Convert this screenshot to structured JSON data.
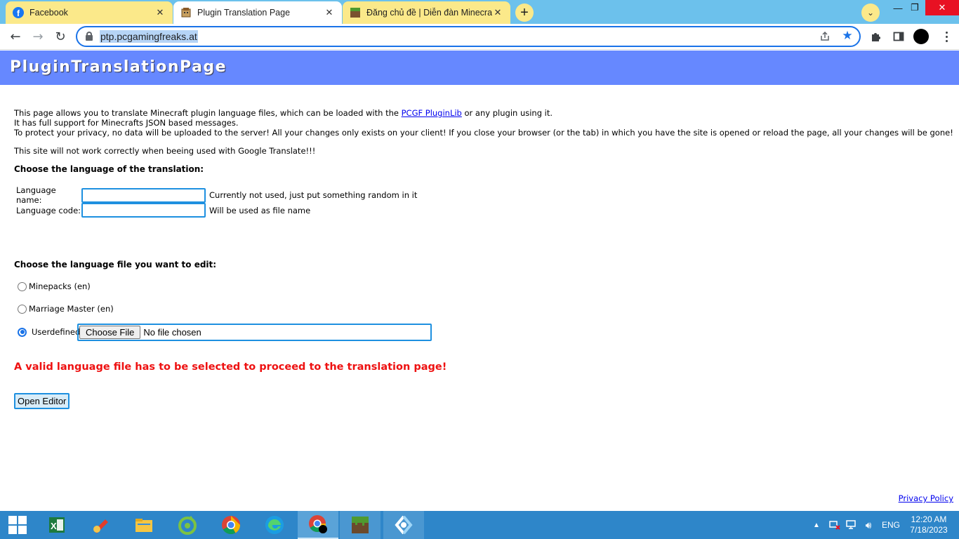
{
  "browser": {
    "tabs": [
      {
        "label": "Facebook",
        "icon": "facebook-icon",
        "active": false
      },
      {
        "label": "Plugin Translation Page",
        "icon": "ptp-favicon-icon",
        "active": true
      },
      {
        "label": "Đăng chủ đề | Diễn đàn Minecraft",
        "icon": "minecraft-grass-icon",
        "active": false
      }
    ],
    "new_tab_symbol": "+",
    "url": "ptp.pcgamingfreaks.at",
    "accent_color": "#1a73e8"
  },
  "page": {
    "banner_title": "PluginTranslationPage",
    "banner_color": "#6688ff",
    "intro_part1": "This page allows you to translate Minecraft plugin language files, which can be loaded with the ",
    "intro_link": "PCGF PluginLib",
    "intro_part2": " or any plugin using it.",
    "intro_line2": "It has full support for Minecrafts JSON based messages.",
    "intro_line3": "To protect your privacy, no data will be uploaded to the server! All your changes only exists on your client! If you close your browser (or the tab) in which you have the site is opened or reload the page, all your changes will be gone!",
    "gt_warning": "This site will not work correctly when beeing used with Google Translate!!!",
    "lang_heading": "Choose the language of the translation:",
    "language_name": {
      "label": "Language name:",
      "value": "",
      "hint": "Currently not used, just put something random in it"
    },
    "language_code": {
      "label": "Language code:",
      "value": "",
      "hint": "Will be used as file name"
    },
    "file_heading": "Choose the language file you want to edit:",
    "file_options": [
      {
        "label": "Minepacks (en)",
        "checked": false
      },
      {
        "label": "Marriage Master (en)",
        "checked": false
      },
      {
        "label": "Userdefined",
        "checked": true
      }
    ],
    "choose_file_label": "Choose File",
    "file_status": "No file chosen",
    "error_message": "A valid language file has to be selected to proceed to the translation page!",
    "error_color": "#ee1111",
    "open_editor_label": "Open Editor",
    "privacy_link": "Privacy Policy"
  },
  "taskbar": {
    "apps": [
      "windows-start-icon",
      "excel-icon",
      "ccleaner-icon",
      "file-explorer-icon",
      "coccoc-icon",
      "chrome-icon",
      "edge-icon",
      "chrome-profile-icon",
      "minecraft-icon",
      "app-launcher-icon"
    ],
    "language": "ENG",
    "time": "12:20 AM",
    "date": "7/18/2023"
  }
}
